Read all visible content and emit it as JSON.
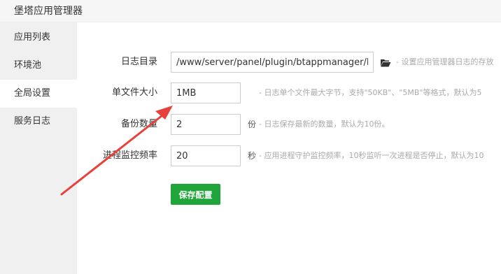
{
  "window": {
    "title": "堡塔应用管理器"
  },
  "sidebar": {
    "items": [
      {
        "label": "应用列表",
        "active": false
      },
      {
        "label": "环境池",
        "active": false
      },
      {
        "label": "全局设置",
        "active": true
      },
      {
        "label": "服务日志",
        "active": false
      }
    ]
  },
  "form": {
    "log_dir": {
      "label": "日志目录",
      "value": "/www/server/panel/plugin/btappmanager/logs",
      "icon": "folder-open-icon",
      "hint": "- 设置应用管理器日志的存放"
    },
    "file_size": {
      "label": "单文件大小",
      "value": "1MB",
      "hint": "- 日志单个文件最大字节，支持\"50KB\"、\"5MB\"等格式，默认为5"
    },
    "backup_count": {
      "label": "备份数量",
      "value": "2",
      "unit": "份",
      "hint": "- 日志保存最新的数量，默认为10份。"
    },
    "monitor_freq": {
      "label": "进程监控频率",
      "value": "20",
      "unit": "秒",
      "hint": "- 应用进程守护监控频率，10秒监听一次进程是否停止，默认为10"
    },
    "save_label": "保存配置"
  },
  "colors": {
    "accent_green": "#20a53a",
    "annotation_arrow": "#e8413c"
  }
}
